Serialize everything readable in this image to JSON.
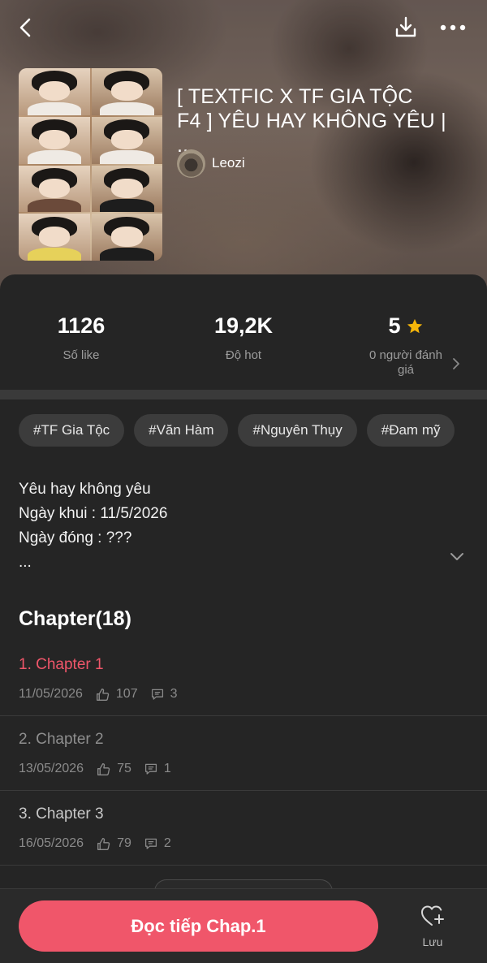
{
  "header": {
    "title": "[ TEXTFIC X TF GIA TỘC\nF4 ] YÊU HAY KHÔNG YÊU | ...",
    "author": "Leozi"
  },
  "stats": {
    "likes": {
      "value": "1126",
      "label": "Số like"
    },
    "hot": {
      "value": "19,2K",
      "label": "Độ hot"
    },
    "rating": {
      "value": "5",
      "label": "0 người đánh giá"
    }
  },
  "tags": [
    "#TF Gia Tộc",
    "#Văn Hàm",
    "#Nguyên Thụy",
    "#Đam mỹ"
  ],
  "description": {
    "lines": [
      "Yêu hay không yêu",
      "Ngày khui : 11/5/2026",
      "Ngày đóng : ???",
      "..."
    ]
  },
  "chapters": {
    "heading": "Chapter(18)",
    "items": [
      {
        "title": "1. Chapter 1",
        "date": "11/05/2026",
        "likes": "107",
        "comments": "3"
      },
      {
        "title": "2. Chapter 2",
        "date": "13/05/2026",
        "likes": "75",
        "comments": "1"
      },
      {
        "title": "3. Chapter 3",
        "date": "16/05/2026",
        "likes": "79",
        "comments": "2"
      }
    ]
  },
  "bottom": {
    "read_label": "Đọc tiếp Chap.1",
    "save_label": "Lưu"
  },
  "colors": {
    "accent": "#f0566a",
    "star": "#f5b50a",
    "background": "#252525"
  },
  "icons": [
    "back-arrow-icon",
    "download-icon",
    "more-icon",
    "star-icon",
    "chevron-right-icon",
    "chevron-down-icon",
    "thumbs-up-icon",
    "comment-icon",
    "heart-plus-icon"
  ]
}
